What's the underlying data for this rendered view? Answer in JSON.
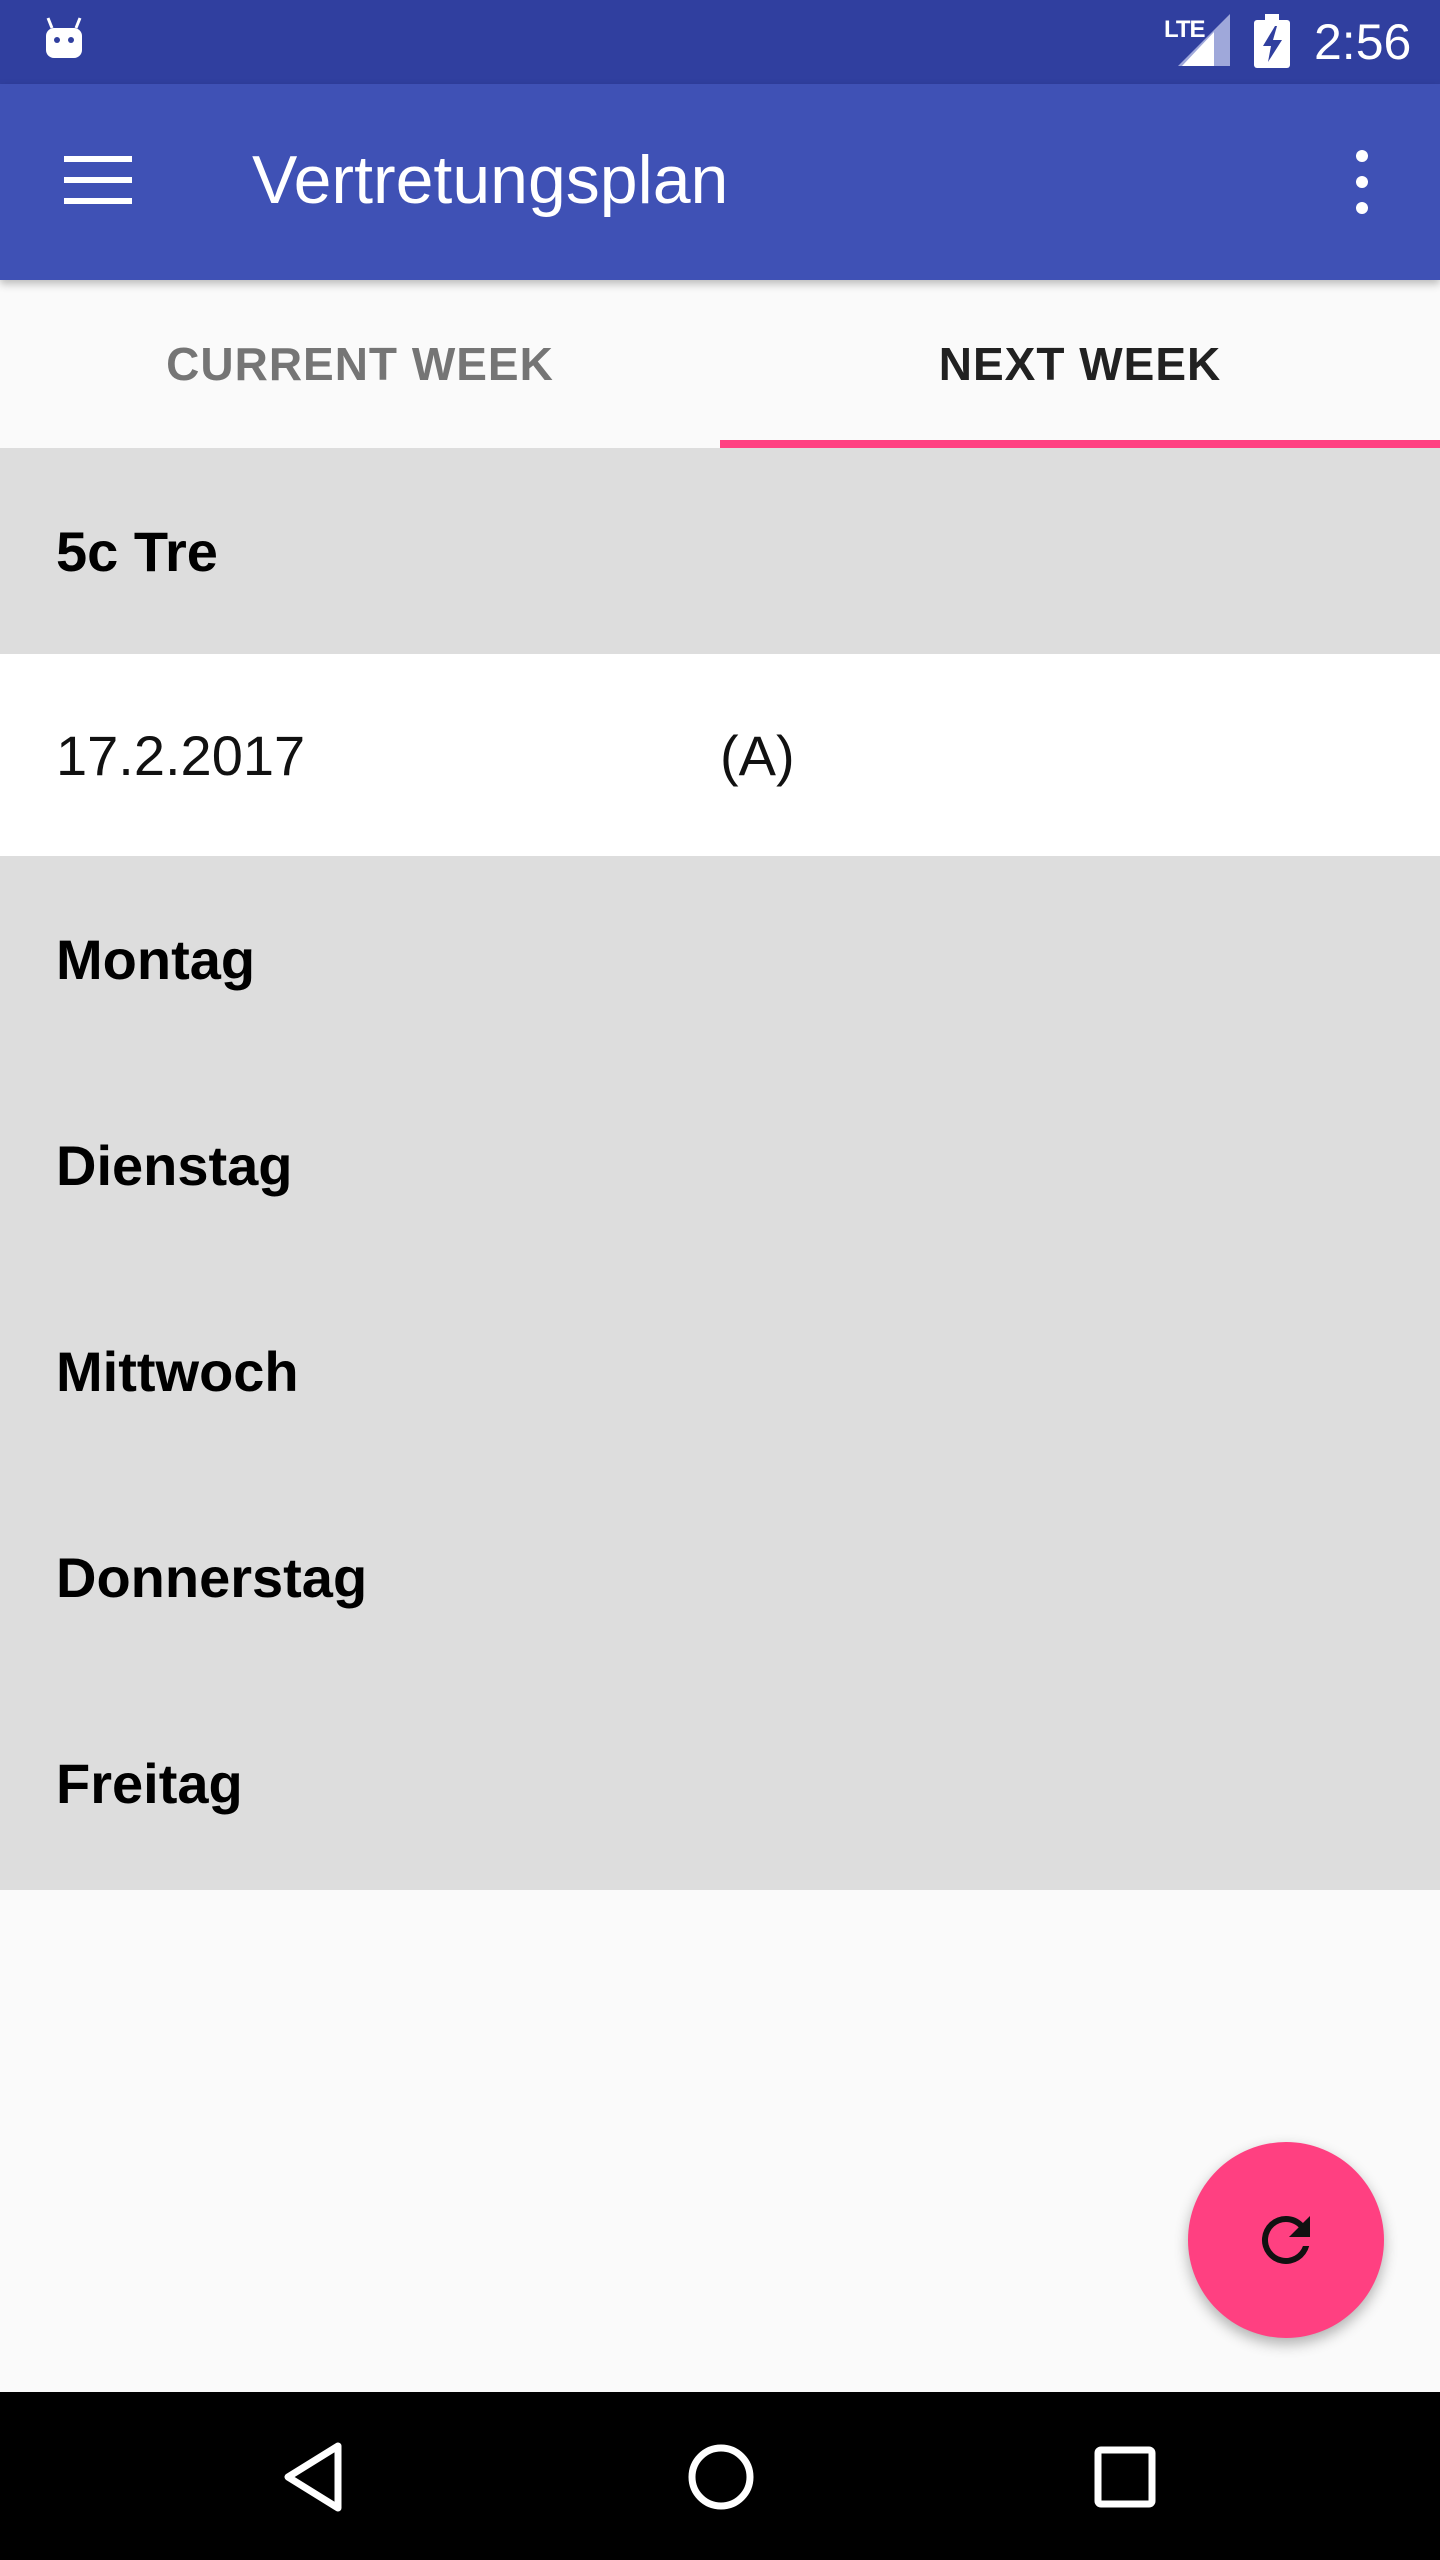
{
  "status_bar": {
    "network_label": "LTE",
    "time": "2:56",
    "icons": [
      "android-notification-icon",
      "signal-icon",
      "battery-icon"
    ]
  },
  "app_bar": {
    "title": "Vertretungsplan",
    "icons": [
      "menu-icon",
      "more-vert-icon"
    ],
    "color": "#3f51b5"
  },
  "tabs": {
    "items": [
      {
        "label": "CURRENT WEEK",
        "selected": false
      },
      {
        "label": "NEXT WEEK",
        "selected": true
      }
    ],
    "indicator_color": "#ff4081"
  },
  "plan": {
    "class_name": "5c Tre",
    "date": "17.2.2017",
    "week_type": "(A)",
    "days": [
      "Montag",
      "Dienstag",
      "Mittwoch",
      "Donnerstag",
      "Freitag"
    ]
  },
  "fab": {
    "icon": "refresh-icon",
    "color": "#ff4081"
  },
  "nav_bar": {
    "icons": [
      "back-icon",
      "home-icon",
      "recents-icon"
    ]
  }
}
